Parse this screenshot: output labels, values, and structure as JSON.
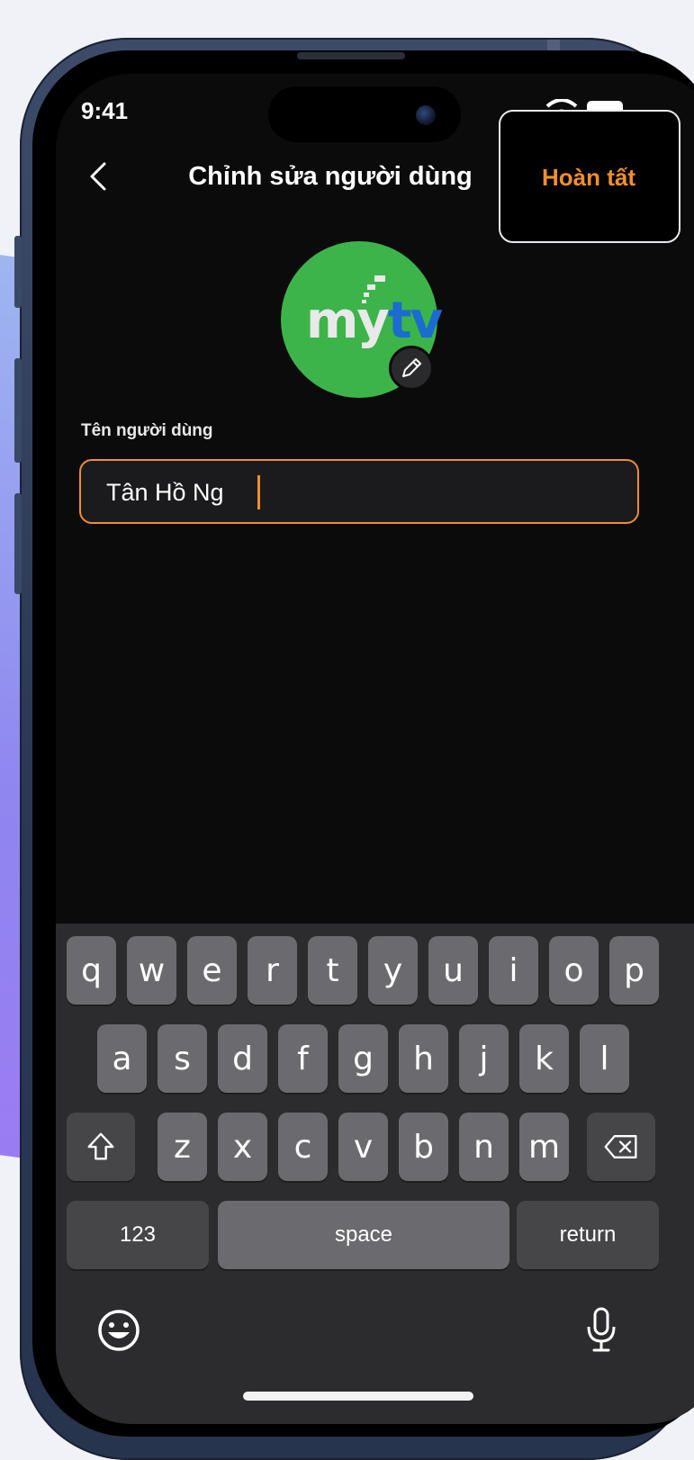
{
  "status_bar": {
    "time": "9:41"
  },
  "nav": {
    "title": "Chỉnh sửa người dùng",
    "done_label": "Hoàn tất"
  },
  "avatar": {
    "logo_part1": "my",
    "logo_part2": "tv"
  },
  "form": {
    "label": "Tên người dùng",
    "name_value": "Tân Hồ Ng"
  },
  "keyboard": {
    "row1": [
      "q",
      "w",
      "e",
      "r",
      "t",
      "y",
      "u",
      "i",
      "o",
      "p"
    ],
    "row2": [
      "a",
      "s",
      "d",
      "f",
      "g",
      "h",
      "j",
      "k",
      "l"
    ],
    "row3": [
      "z",
      "x",
      "c",
      "v",
      "b",
      "n",
      "m"
    ],
    "numbers_label": "123",
    "space_label": "space",
    "return_label": "return"
  },
  "colors": {
    "accent": "#ef8f2b",
    "background": "#0b0b0c",
    "avatar_green": "#3cb44a",
    "logo_blue": "#1b6bd1"
  }
}
